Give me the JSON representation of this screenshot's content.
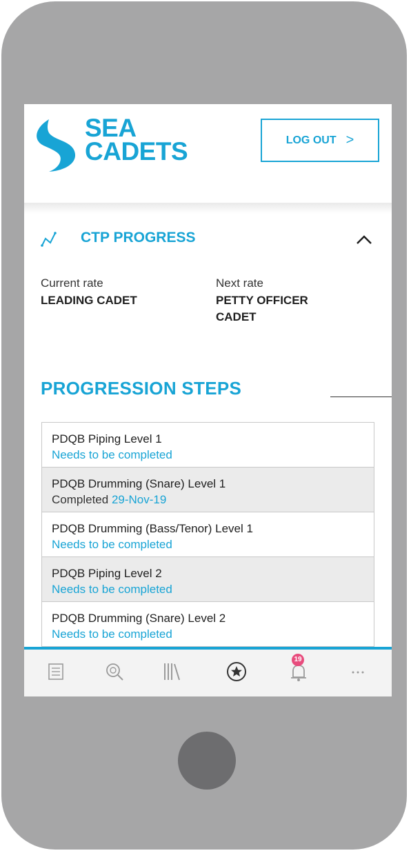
{
  "brand": {
    "line1": "SEA",
    "line2": "CADETS",
    "color": "#18a4d5"
  },
  "header": {
    "logout_label": "LOG OUT",
    "logout_chevron": ">"
  },
  "progress": {
    "icon": "trend-line-icon",
    "title": "CTP PROGRESS",
    "collapse_icon": "chevron-up-icon",
    "current_rate_label": "Current rate",
    "current_rate_value": "LEADING CADET",
    "next_rate_label": "Next rate",
    "next_rate_value_line1": "PETTY OFFICER",
    "next_rate_value_line2": "CADET"
  },
  "steps": {
    "title": "PROGRESSION STEPS",
    "items": [
      {
        "name": "PDQB Piping Level 1",
        "status": "Needs to be completed"
      },
      {
        "name": "PDQB Drumming (Snare) Level 1",
        "status_prefix": "Completed",
        "status_date": "29-Nov-19"
      },
      {
        "name": "PDQB Drumming (Bass/Tenor) Level 1",
        "status": "Needs to be completed"
      },
      {
        "name": "PDQB Piping Level 2",
        "status": "Needs to be completed"
      },
      {
        "name": "PDQB Drumming (Snare) Level 2",
        "status": "Needs to be completed"
      }
    ]
  },
  "nav": {
    "items": [
      {
        "icon": "list-icon"
      },
      {
        "icon": "search-icon"
      },
      {
        "icon": "library-icon"
      },
      {
        "icon": "star-icon"
      },
      {
        "icon": "notification-bell-icon",
        "badge": "19"
      },
      {
        "icon": "more-icon"
      }
    ]
  },
  "colors": {
    "accent": "#18a4d5",
    "badge": "#e84c7d",
    "phone_frame": "#a6a6a7",
    "home_button": "#6d6d6f"
  }
}
